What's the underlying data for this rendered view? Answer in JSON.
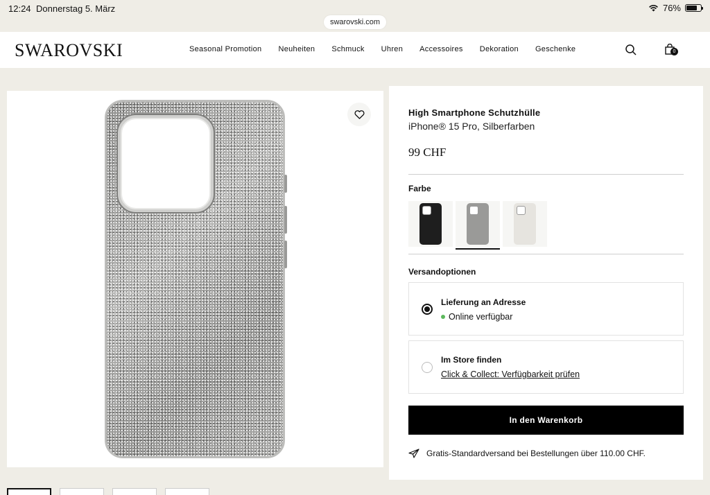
{
  "status_bar": {
    "time": "12:24",
    "date": "Donnerstag 5. März",
    "battery": "76%",
    "battery_level": 0.76
  },
  "browser": {
    "url": "swarovski.com"
  },
  "header": {
    "logo": "SWAROVSKI",
    "nav": [
      "Seasonal Promotion",
      "Neuheiten",
      "Schmuck",
      "Uhren",
      "Accessoires",
      "Dekoration",
      "Geschenke"
    ],
    "cart_count": "0"
  },
  "product": {
    "title": "High Smartphone Schutzhülle",
    "subtitle": "iPhone® 15 Pro, Silberfarben",
    "price": "99 CHF",
    "color_label": "Farbe",
    "colors": [
      {
        "name": "black",
        "hex": "#1e1e1e"
      },
      {
        "name": "silver",
        "hex": "#9a9a98"
      },
      {
        "name": "white",
        "hex": "#e6e4df"
      }
    ],
    "selected_color_index": 1
  },
  "shipping": {
    "label": "Versandoptionen",
    "options": [
      {
        "title": "Lieferung an Adresse",
        "detail": "Online verfügbar",
        "selected": true
      },
      {
        "title": "Im Store finden",
        "detail": "Click & Collect: Verfügbarkeit prüfen",
        "selected": false
      }
    ]
  },
  "cart_button": "In den Warenkorb",
  "shipping_note": "Gratis-Standardversand bei Bestellungen über 110.00 CHF.",
  "icons": [
    "wifi-icon",
    "battery-icon",
    "search-icon",
    "bag-icon",
    "heart-icon",
    "paper-plane-icon"
  ]
}
